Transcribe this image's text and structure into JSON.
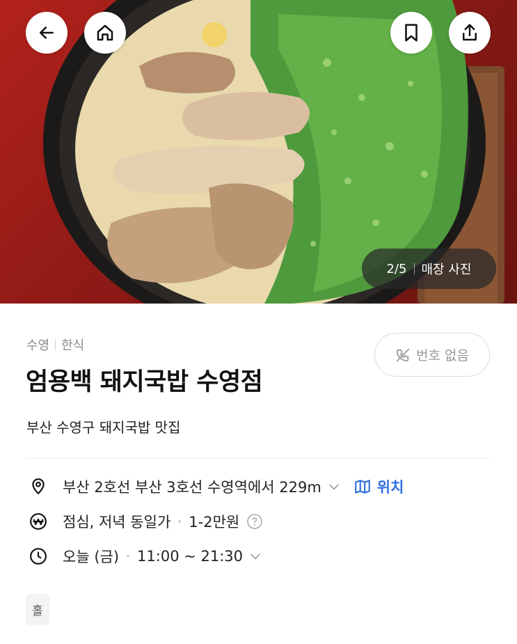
{
  "header": {
    "back_icon": "arrow-left-icon",
    "home_icon": "home-icon",
    "bookmark_icon": "bookmark-icon",
    "share_icon": "share-icon"
  },
  "photo": {
    "counter": "2/5",
    "label": "매장 사진",
    "subject": "돼지국밥 photo"
  },
  "restaurant": {
    "area": "수영",
    "category": "한식",
    "name": "엄용백 돼지국밥 수영점",
    "description": "부산 수영구 돼지국밥 맛집",
    "phone_button": "번호 없음",
    "phone_icon": "phone-off-icon"
  },
  "info": {
    "location": {
      "icon": "location-pin-icon",
      "text": "부산 2호선 부산 3호선 수영역에서 229m",
      "map_label": "위치",
      "map_icon": "map-icon"
    },
    "price": {
      "icon": "won-icon",
      "meal": "점심, 저녁 동일가",
      "range": "1-2만원",
      "help_icon": "question-icon"
    },
    "hours": {
      "icon": "clock-icon",
      "day": "오늘 (금)",
      "time": "11:00 ~ 21:30"
    }
  },
  "tags": [
    "홀"
  ],
  "colors": {
    "accent": "#2f6fe0",
    "muted": "#8a8a8a",
    "counter_bg": "#282828"
  }
}
